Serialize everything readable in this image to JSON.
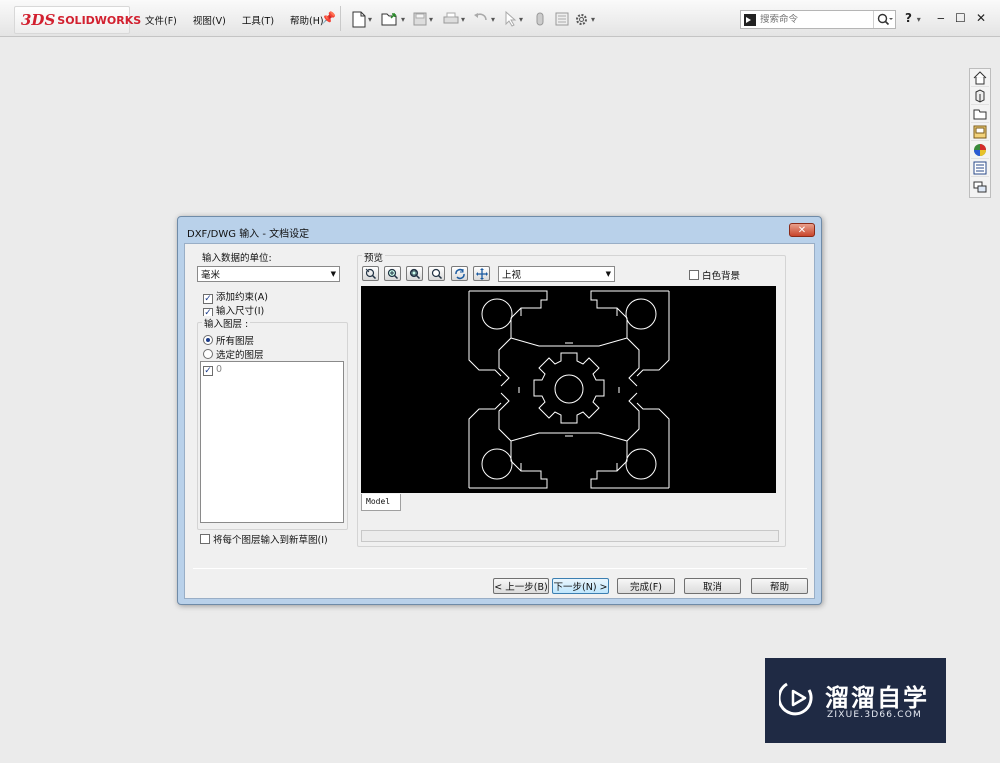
{
  "app": {
    "logo_mark": "3DS",
    "logo_word_1": "SOLID",
    "logo_word_2": "WORKS"
  },
  "menu": {
    "items": [
      "文件(F)",
      "视图(V)",
      "工具(T)",
      "帮助(H)"
    ]
  },
  "toolbar": {
    "icons": [
      "new-document-icon",
      "open-icon",
      "save-icon",
      "print-icon",
      "undo-icon",
      "select-icon",
      "rebuild-icon",
      "file-properties-icon",
      "options-gear-icon"
    ]
  },
  "search": {
    "placeholder": "搜索命令"
  },
  "window_controls": {
    "help": "?",
    "minimize": "‒",
    "maximize": "☐",
    "close": "✕"
  },
  "task_pane": {
    "icons": [
      "home-icon",
      "design-library-icon",
      "file-explorer-icon",
      "view-palette-icon",
      "appearances-icon",
      "custom-properties-icon",
      "forum-icon"
    ]
  },
  "dialog": {
    "title": "DXF/DWG 输入 - 文档设定",
    "close": "✕",
    "units_label": "输入数据的单位:",
    "units_value": "毫米",
    "add_constraints": "添加约束(A)",
    "add_constraints_checked": true,
    "import_dimensions": "输入尺寸(I)",
    "import_dimensions_checked": true,
    "layers_label": "输入图层 :",
    "all_layers": "所有图层",
    "selected_layers": "选定的图层",
    "layer_selection": "all",
    "layer_items": [
      {
        "name": "0",
        "checked": true
      }
    ],
    "each_layer_sketch": "将每个图层输入到新草图(I)",
    "each_layer_sketch_checked": false,
    "preview_label": "预览",
    "view_value": "上视",
    "white_bg": "白色背景",
    "white_bg_checked": false,
    "preview_tools": [
      "zoom-fit-icon",
      "zoom-in-icon",
      "zoom-area-icon",
      "zoom-previous-icon",
      "rotate-icon",
      "pan-icon"
    ],
    "model_tab": "Model",
    "buttons": {
      "back": "< 上一步(B)",
      "next": "下一步(N) >",
      "finish": "完成(F)",
      "cancel": "取消",
      "help": "帮助"
    }
  },
  "watermark": {
    "name": "溜溜自学",
    "url": "ZIXUE.3D66.COM"
  },
  "colors": {
    "brand_red": "#d2202f",
    "dialog_frame": "#b9d1ea",
    "preview_bg": "#000000",
    "watermark_bg": "#1f2a44"
  }
}
